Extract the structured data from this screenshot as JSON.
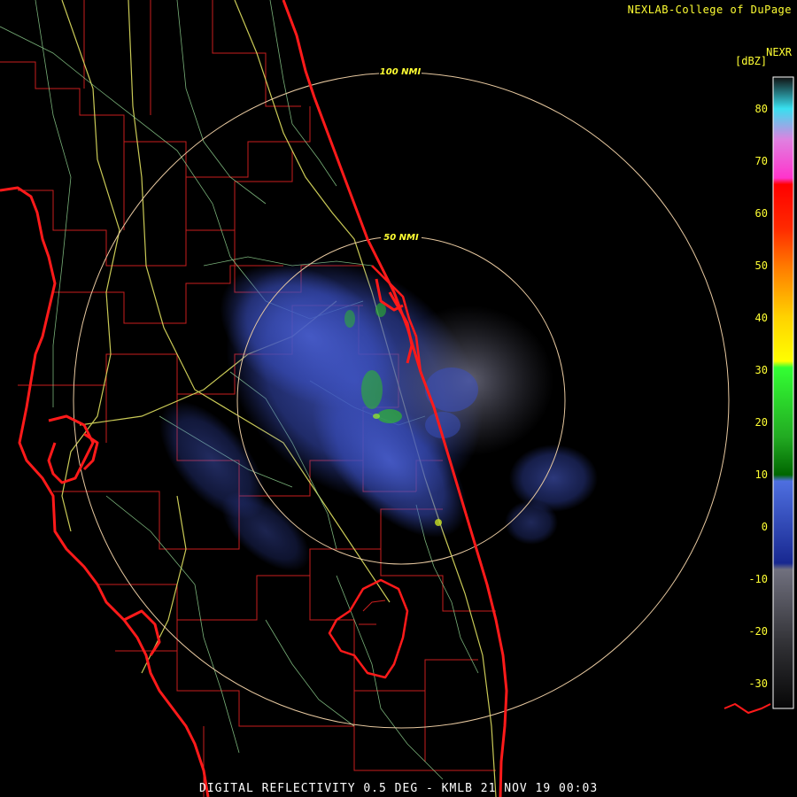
{
  "header": {
    "credit": "NEXLAB-College of DuPage"
  },
  "footer": {
    "caption": "DIGITAL REFLECTIVITY 0.5 DEG - KMLB 21 NOV 19 00:03"
  },
  "rings": [
    {
      "label": "100 NMI"
    },
    {
      "label": "50 NMI"
    }
  ],
  "colorbar": {
    "product": "NEXR",
    "unit": "[dBZ]",
    "ticks": [
      "80",
      "70",
      "60",
      "50",
      "40",
      "30",
      "20",
      "10",
      "0",
      "-10",
      "-20",
      "-30"
    ]
  },
  "colors": {
    "background": "#000000",
    "coastline": "#ff1a1a",
    "county_lines": "#c81e1e",
    "highways": "#ffff66",
    "roads": "#8fd18f",
    "range_rings": "#e8c9a0",
    "echo_weak": "#4a5fd0",
    "echo_moderate": "#2db52d",
    "clutter": "#6e6e80"
  }
}
